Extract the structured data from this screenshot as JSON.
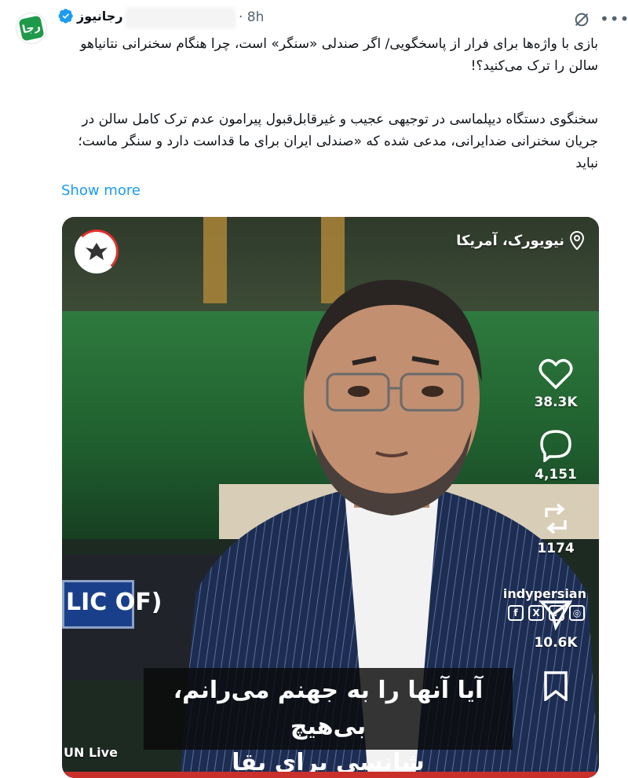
{
  "header": {
    "author_name": "رجانیوز",
    "time": "· 8h",
    "avatar_text": "رجا",
    "icons": [
      "grok-icon",
      "more-icon",
      "verified-badge-icon"
    ]
  },
  "tweet": {
    "paragraph1": "بازی با واژه‌ها برای فرار از پاسخگویی/ اگر صندلی «سنگر» است، چرا هنگام سخنرانی نتانیاهو سالن را ترک می‌کنید؟!",
    "paragraph2": "سخنگوی دستگاه دیپلماسی در توجیهی عجیب و غیرقابل‌قبول پیرامون عدم ترک کامل سالن در جریان سخنرانی ضدایرانی، مدعی شده که «صندلی ایران برای ما قداست دارد و سنگر ماست؛ نباید",
    "show_more": "Show more"
  },
  "media": {
    "location": "نیویورک، آمریکا",
    "nameplate": "LIC OF)",
    "watermark": "indypersian",
    "social_icons": [
      "f",
      "X",
      "♪",
      "◎"
    ],
    "subtitle_line1": "آیا آنها را به جهنم می‌رانم، بی‌هیچ",
    "subtitle_line2": "شانسی برای بقا",
    "source": "UN Live",
    "actions": {
      "likes": "38.3K",
      "comments": "4,151",
      "reposts": "1174",
      "shares": "10.6K"
    },
    "accent_red": "#c9302c",
    "brand_green": "#1f9a4a"
  }
}
